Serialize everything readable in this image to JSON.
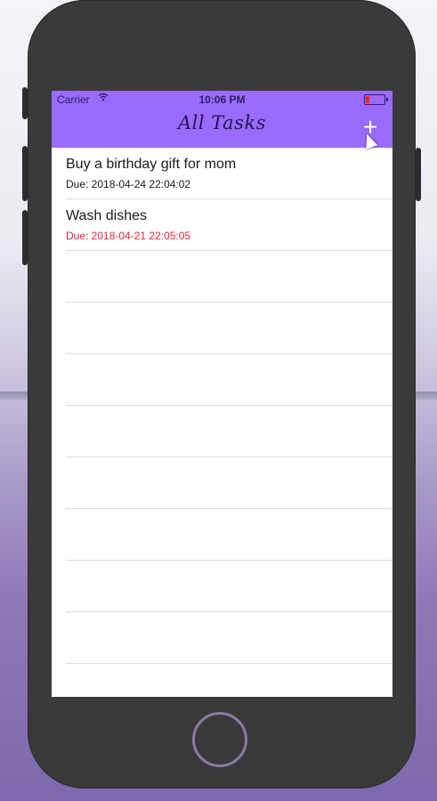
{
  "status": {
    "carrier": "Carrier",
    "wifi_icon": "wifi-icon",
    "time": "10:06 PM"
  },
  "navbar": {
    "title": "All Tasks",
    "add_label": "+"
  },
  "tasks": [
    {
      "title": "Buy a birthday gift for mom",
      "due": "Due: 2018-04-24 22:04:02",
      "overdue": false
    },
    {
      "title": "Wash dishes",
      "due": "Due: 2018-04-21 22:05:05",
      "overdue": true
    }
  ],
  "colors": {
    "nav": "#9b6bff",
    "overdue": "#e5253f"
  }
}
